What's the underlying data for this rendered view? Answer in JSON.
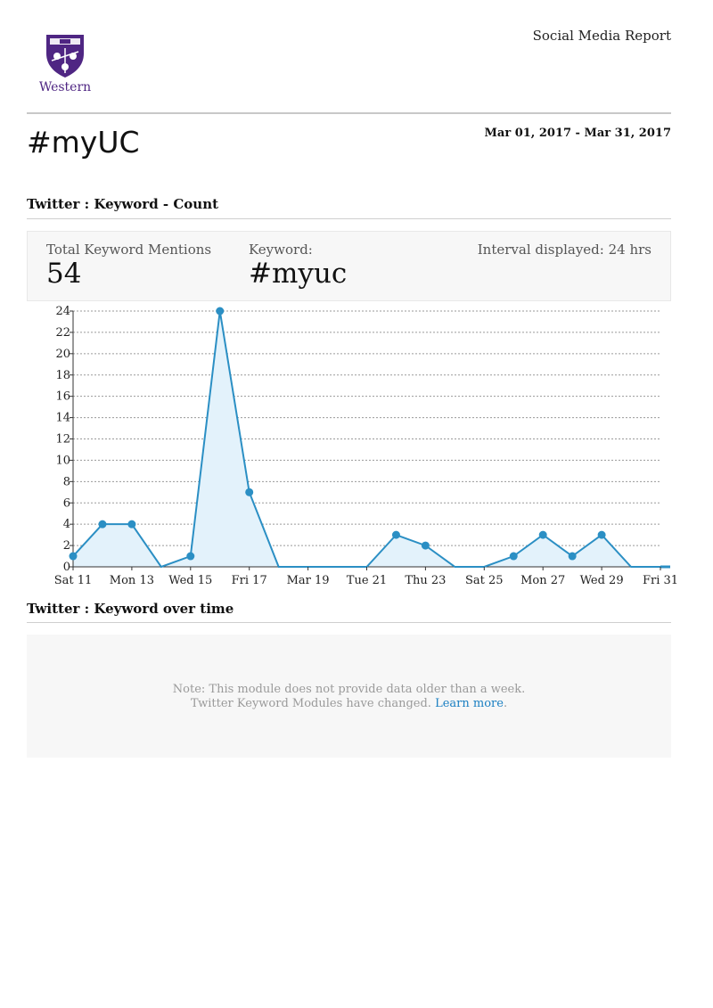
{
  "header": {
    "logo_text": "Western",
    "report_title": "Social Media Report",
    "page_title": "#myUC",
    "date_range": "Mar 01, 2017 - Mar 31, 2017"
  },
  "section1": {
    "title": "Twitter : Keyword - Count",
    "total_label": "Total Keyword Mentions",
    "total_value": "54",
    "keyword_label": "Keyword:",
    "keyword_value": "#myuc",
    "interval": "Interval displayed: 24 hrs"
  },
  "section2": {
    "title": "Twitter : Keyword over time",
    "note_line1": "Note: This module does not provide data older than a week.",
    "note_line2_prefix": "Twitter Keyword Modules have changed.",
    "note_link": "Learn more",
    "note_suffix": "."
  },
  "colors": {
    "line": "#2b8fc4",
    "fill": "#e3f2fb",
    "brand": "#4f2683",
    "link": "#1a7fc2"
  },
  "chart_data": {
    "type": "area",
    "x": [
      "Mar 11",
      "Mar 12",
      "Mar 13",
      "Mar 14",
      "Mar 15",
      "Mar 16",
      "Mar 17",
      "Mar 18",
      "Mar 19",
      "Mar 20",
      "Mar 21",
      "Mar 22",
      "Mar 23",
      "Mar 24",
      "Mar 25",
      "Mar 26",
      "Mar 27",
      "Mar 28",
      "Mar 29",
      "Mar 30",
      "Mar 31"
    ],
    "values": [
      1,
      4,
      4,
      0,
      1,
      24,
      7,
      0,
      0,
      0,
      0,
      3,
      2,
      0,
      0,
      1,
      3,
      1,
      3,
      0,
      0
    ],
    "markers": [
      true,
      true,
      true,
      false,
      true,
      true,
      true,
      false,
      false,
      false,
      false,
      true,
      true,
      false,
      false,
      true,
      true,
      true,
      true,
      false,
      false
    ],
    "x_tick_labels": [
      "Sat 11",
      "Mon 13",
      "Wed 15",
      "Fri 17",
      "Mar 19",
      "Tue 21",
      "Thu 23",
      "Sat 25",
      "Mon 27",
      "Wed 29",
      "Fri 31"
    ],
    "y_ticks": [
      "0",
      "2",
      "4",
      "6",
      "8",
      "10",
      "12",
      "14",
      "16",
      "18",
      "20",
      "22",
      "24"
    ],
    "ylim": [
      0,
      24
    ],
    "grid": true
  }
}
